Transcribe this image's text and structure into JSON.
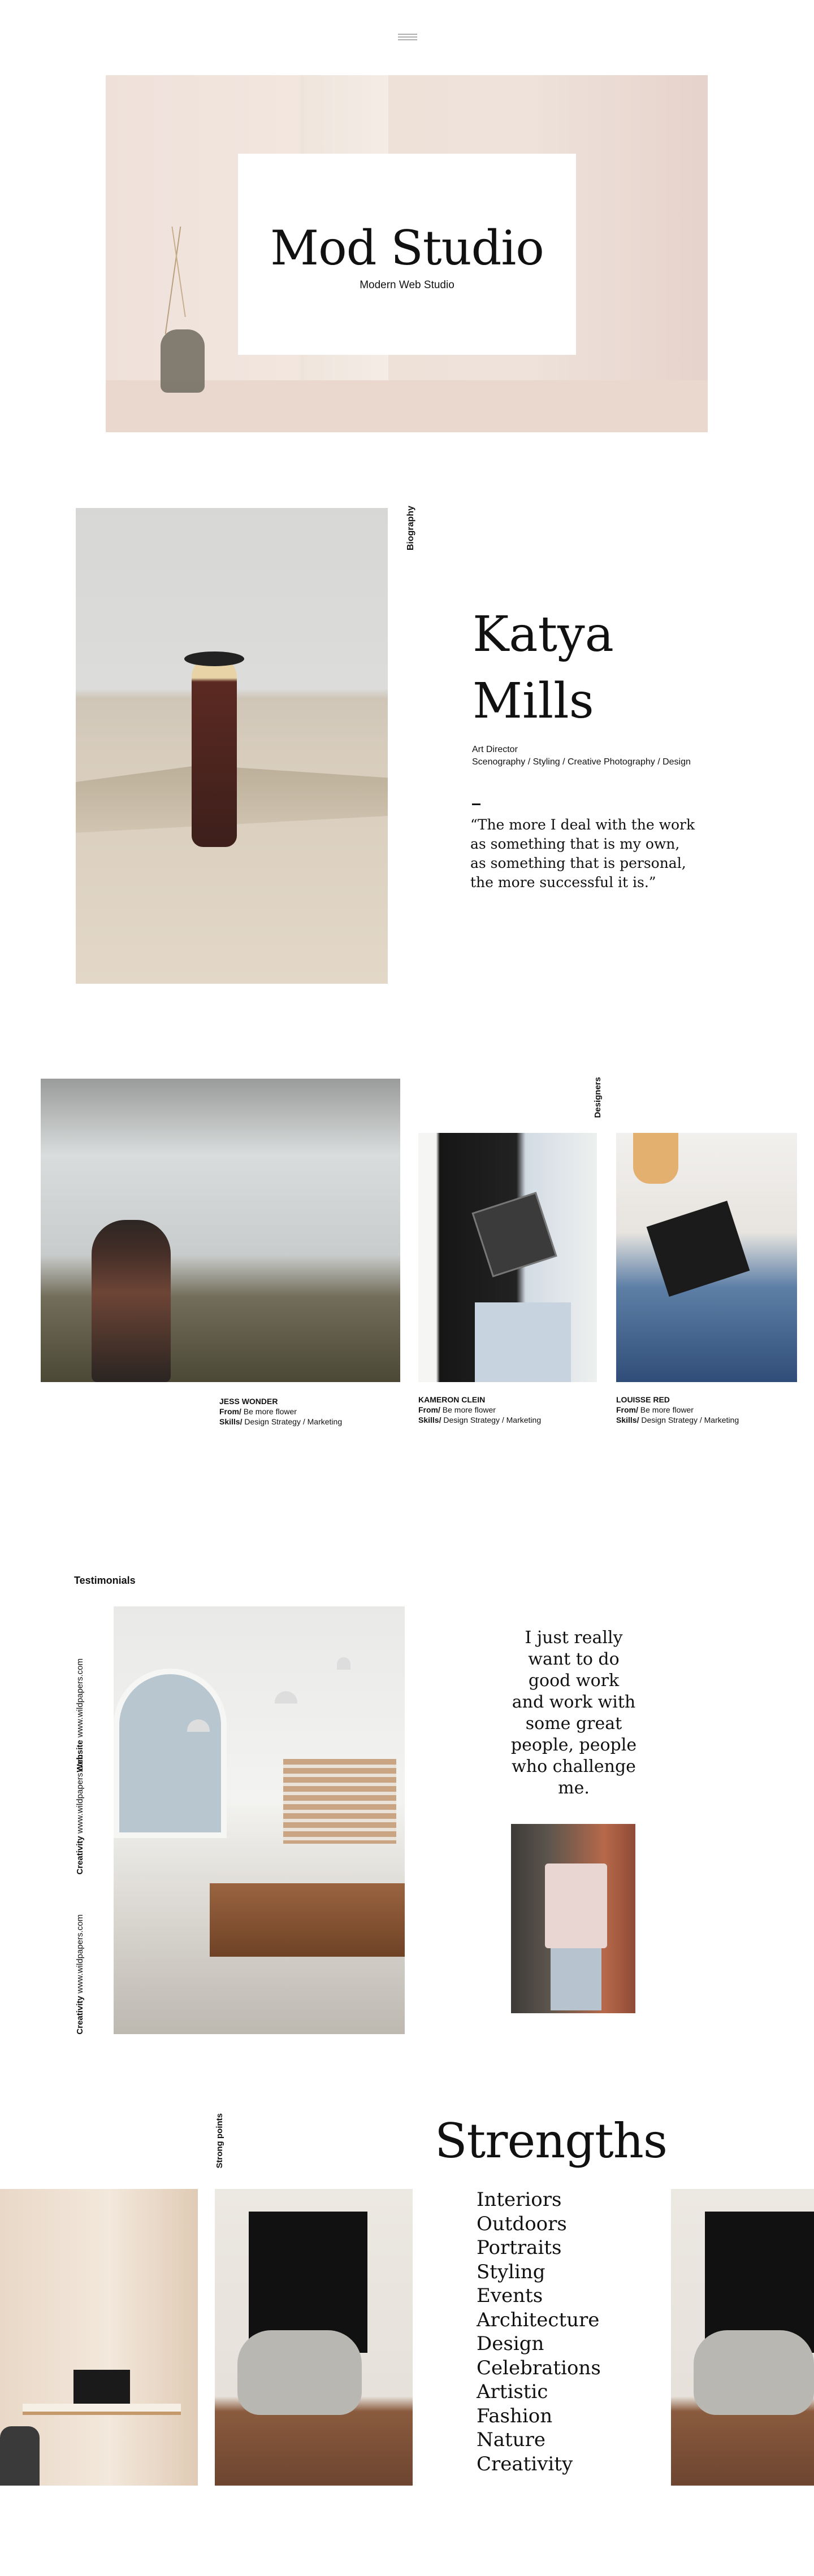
{
  "nav": {
    "menu_icon": "hamburger-menu-icon"
  },
  "hero": {
    "title": "Mod Studio",
    "subtitle": "Modern Web Studio"
  },
  "biography": {
    "label": "Biography",
    "name_line1": "Katya",
    "name_line2": "Mills",
    "role_title": "Art Director",
    "role_skills": "Scenography / Styling / Creative Photography / Design",
    "quote_lines": [
      "“The more I deal with the work",
      "as something that is my own,",
      "as something that is personal,",
      "the more successful it is.”"
    ]
  },
  "designers": {
    "label": "Designers",
    "from_label": "From/",
    "skills_label": "Skills/",
    "items": [
      {
        "name": "JESS WONDER",
        "from": "Be more flower",
        "skills": "Design Strategy / Marketing"
      },
      {
        "name": "KAMERON CLEIN",
        "from": "Be more flower",
        "skills": "Design Strategy / Marketing"
      },
      {
        "name": "LOUISSE RED",
        "from": "Be more flower",
        "skills": "Design Strategy / Marketing"
      }
    ]
  },
  "testimonials": {
    "label": "Testimonials",
    "sites": [
      {
        "label": "Website",
        "url": "www.wildpapers.com"
      },
      {
        "label": "Creativity",
        "url": "www.wildpapers.com"
      },
      {
        "label": "Creativity",
        "url": "www.wildpapers.com"
      }
    ],
    "quote_lines": [
      "I just really",
      "want to do",
      "good work",
      "and work with",
      "some great",
      "people, people",
      "who challenge",
      "me."
    ]
  },
  "strengths": {
    "label": "Strong points",
    "title": "Strengths",
    "items": [
      "Interiors",
      "Outdoors",
      "Portraits",
      "Styling",
      "Events",
      "Architecture",
      "Design",
      "Celebrations",
      "Artistic",
      "Fashion",
      "Nature",
      "Creativity"
    ]
  }
}
